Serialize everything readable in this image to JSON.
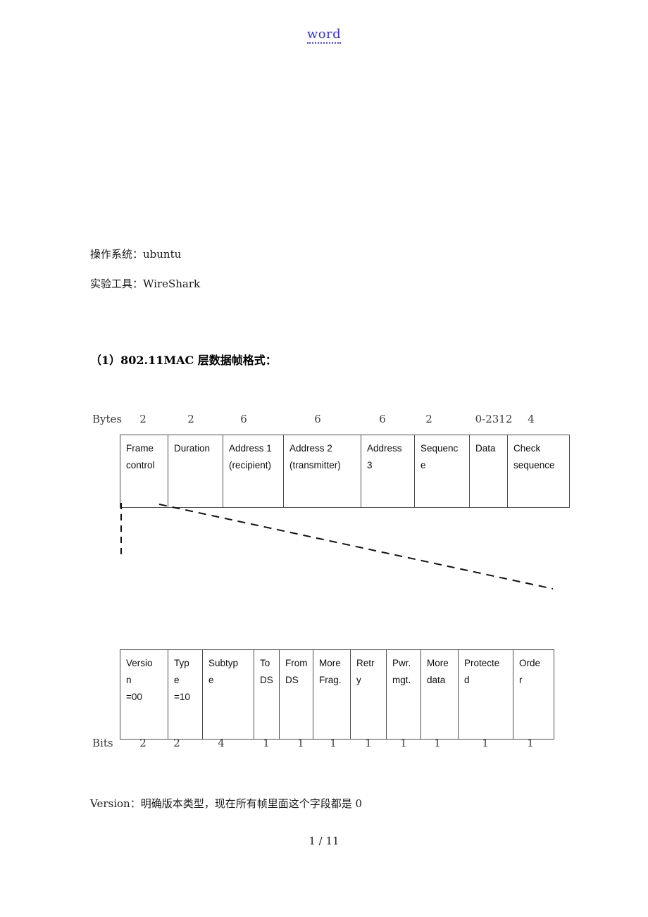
{
  "header": {
    "link_text": "word",
    "link_color": "#3333cc"
  },
  "body_text": {
    "os_line": "操作系统：ubuntu",
    "tool_line": "实验工具：WireShark",
    "heading": "（1）802.11MAC 层数据帧格式：",
    "version_note": "Version：明确版本类型，现在所有帧里面这个字段都是 0"
  },
  "bytes_row": {
    "label": "Bytes",
    "values": [
      "2",
      "2",
      "6",
      "6",
      "6",
      "2",
      "0-2312",
      "4"
    ]
  },
  "bits_row": {
    "label": "Bits",
    "values": [
      "2",
      "2",
      "4",
      "1",
      "1",
      "1",
      "1",
      "1",
      "1",
      "1",
      "1"
    ]
  },
  "mac_frame_table": {
    "cells": [
      "Frame\ncontrol",
      "Duration",
      "Address 1\n(recipient)",
      "Address 2\n(transmitter)",
      "Address\n3",
      "Sequenc\ne",
      "Data",
      "Check\nsequence"
    ]
  },
  "frame_control_table": {
    "cells": [
      "Versio\nn\n=00",
      "Typ\ne\n=10",
      "Subtyp\ne",
      "To\nDS",
      "From\nDS",
      "More\nFrag.",
      "Retr\ny",
      "Pwr.\nmgt.",
      "More\ndata",
      "Protecte\nd",
      "Orde\nr"
    ]
  },
  "footer": {
    "page_indicator": "1 / 11"
  },
  "colors": {
    "table_border": "#4d4d4d",
    "text": "#0d0d0d",
    "measure_text": "#3a3a3a",
    "dash_line": "#111111"
  }
}
